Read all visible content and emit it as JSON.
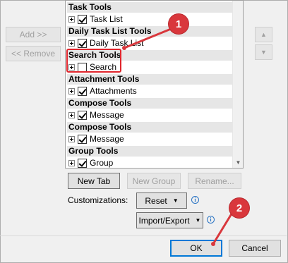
{
  "left_buttons": {
    "add": "Add >>",
    "remove": "<< Remove"
  },
  "move_buttons": {
    "up_glyph": "▲",
    "down_glyph": "▼"
  },
  "tree": {
    "groups": [
      {
        "header": "Task Tools",
        "items": [
          {
            "label": "Task List",
            "checked": true
          }
        ]
      },
      {
        "header": "Daily Task List Tools",
        "items": [
          {
            "label": "Daily Task List",
            "checked": true
          }
        ]
      },
      {
        "header": "Search Tools",
        "items": [
          {
            "label": "Search",
            "checked": false
          }
        ]
      },
      {
        "header": "Attachment Tools",
        "items": [
          {
            "label": "Attachments",
            "checked": true
          }
        ]
      },
      {
        "header": "Compose Tools",
        "items": [
          {
            "label": "Message",
            "checked": true
          }
        ]
      },
      {
        "header": "Compose Tools",
        "items": [
          {
            "label": "Message",
            "checked": true
          }
        ]
      },
      {
        "header": "Group Tools",
        "items": [
          {
            "label": "Group",
            "checked": true
          }
        ]
      }
    ]
  },
  "tree_buttons": {
    "new_tab": "New Tab",
    "new_group": "New Group",
    "rename": "Rename..."
  },
  "customizations": {
    "label": "Customizations:",
    "reset": "Reset",
    "import_export": "Import/Export",
    "info_glyph": "i"
  },
  "footer": {
    "ok": "OK",
    "cancel": "Cancel"
  },
  "callouts": {
    "one": "1",
    "two": "2"
  },
  "colors": {
    "callout": "#d9373c",
    "highlight": "#e0252c",
    "focus": "#0078d7"
  }
}
